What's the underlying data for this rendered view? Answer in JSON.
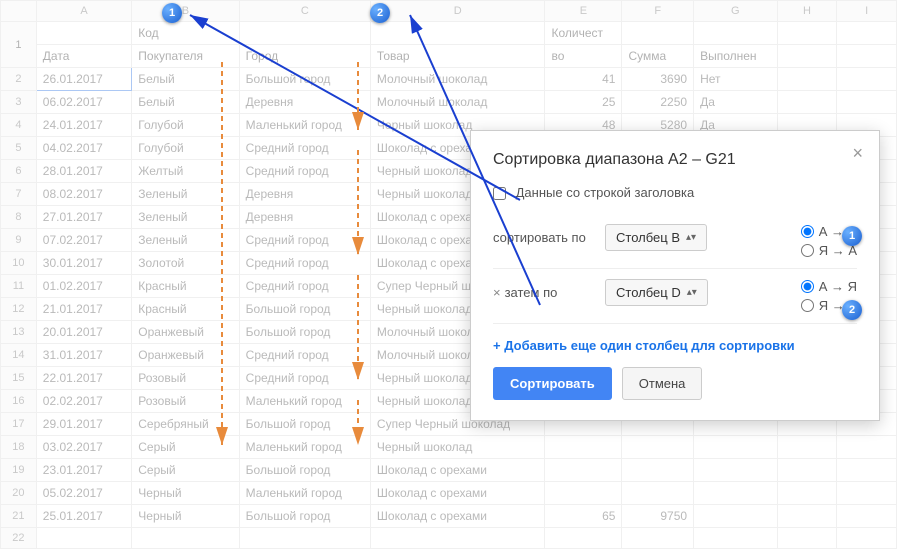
{
  "cols": [
    "A",
    "B",
    "C",
    "D",
    "E",
    "F",
    "G",
    "H",
    "I"
  ],
  "headers": {
    "r1": {
      "B": "Код",
      "E": "Количест"
    },
    "r2": {
      "A": "Дата",
      "B": "Покупателя",
      "C": "Город",
      "D": "Товар",
      "E": "во",
      "F": "Сумма",
      "G": "Выполнен"
    }
  },
  "rows": [
    {
      "n": 2,
      "A": "26.01.2017",
      "B": "Белый",
      "C": "Большой город",
      "D": "Молочный шоколад",
      "E": "41",
      "F": "3690",
      "G": "Нет"
    },
    {
      "n": 3,
      "A": "06.02.2017",
      "B": "Белый",
      "C": "Деревня",
      "D": "Молочный шоколад",
      "E": "25",
      "F": "2250",
      "G": "Да"
    },
    {
      "n": 4,
      "A": "24.01.2017",
      "B": "Голубой",
      "C": "Маленький город",
      "D": "Черный шоколад",
      "E": "48",
      "F": "5280",
      "G": "Да"
    },
    {
      "n": 5,
      "A": "04.02.2017",
      "B": "Голубой",
      "C": "Средний город",
      "D": "Шоколад с орехами",
      "E": "",
      "F": "",
      "G": ""
    },
    {
      "n": 6,
      "A": "28.01.2017",
      "B": "Желтый",
      "C": "Средний город",
      "D": "Черный шоколад",
      "E": "",
      "F": "",
      "G": ""
    },
    {
      "n": 7,
      "A": "08.02.2017",
      "B": "Зеленый",
      "C": "Деревня",
      "D": "Черный шоколад",
      "E": "",
      "F": "",
      "G": ""
    },
    {
      "n": 8,
      "A": "27.01.2017",
      "B": "Зеленый",
      "C": "Деревня",
      "D": "Шоколад с орехами",
      "E": "",
      "F": "",
      "G": ""
    },
    {
      "n": 9,
      "A": "07.02.2017",
      "B": "Зеленый",
      "C": "Средний город",
      "D": "Шоколад с орехами",
      "E": "",
      "F": "",
      "G": ""
    },
    {
      "n": 10,
      "A": "30.01.2017",
      "B": "Золотой",
      "C": "Средний город",
      "D": "Шоколад с орехами",
      "E": "",
      "F": "",
      "G": ""
    },
    {
      "n": 11,
      "A": "01.02.2017",
      "B": "Красный",
      "C": "Средний город",
      "D": "Супер Черный шоколад",
      "E": "",
      "F": "",
      "G": ""
    },
    {
      "n": 12,
      "A": "21.01.2017",
      "B": "Красный",
      "C": "Большой город",
      "D": "Черный шоколад",
      "E": "",
      "F": "",
      "G": ""
    },
    {
      "n": 13,
      "A": "20.01.2017",
      "B": "Оранжевый",
      "C": "Большой город",
      "D": "Молочный шоколад",
      "E": "",
      "F": "",
      "G": ""
    },
    {
      "n": 14,
      "A": "31.01.2017",
      "B": "Оранжевый",
      "C": "Средний город",
      "D": "Молочный шоколад",
      "E": "",
      "F": "",
      "G": ""
    },
    {
      "n": 15,
      "A": "22.01.2017",
      "B": "Розовый",
      "C": "Средний город",
      "D": "Черный шоколад",
      "E": "",
      "F": "",
      "G": ""
    },
    {
      "n": 16,
      "A": "02.02.2017",
      "B": "Розовый",
      "C": "Маленький город",
      "D": "Черный шоколад",
      "E": "",
      "F": "",
      "G": ""
    },
    {
      "n": 17,
      "A": "29.01.2017",
      "B": "Серебряный",
      "C": "Большой город",
      "D": "Супер Черный шоколад",
      "E": "",
      "F": "",
      "G": ""
    },
    {
      "n": 18,
      "A": "03.02.2017",
      "B": "Серый",
      "C": "Маленький город",
      "D": "Черный шоколад",
      "E": "",
      "F": "",
      "G": ""
    },
    {
      "n": 19,
      "A": "23.01.2017",
      "B": "Серый",
      "C": "Большой город",
      "D": "Шоколад с орехами",
      "E": "",
      "F": "",
      "G": ""
    },
    {
      "n": 20,
      "A": "05.02.2017",
      "B": "Черный",
      "C": "Маленький город",
      "D": "Шоколад с орехами",
      "E": "",
      "F": "",
      "G": ""
    },
    {
      "n": 21,
      "A": "25.01.2017",
      "B": "Черный",
      "C": "Большой город",
      "D": "Шоколад с орехами",
      "E": "65",
      "F": "9750",
      "G": ""
    }
  ],
  "dialog": {
    "title": "Сортировка диапазона A2 – G21",
    "checkbox": "Данные со строкой заголовка",
    "sort_by": "сортировать по",
    "then_by": "затем по",
    "col_b": "Столбец B",
    "col_d": "Столбец D",
    "asc": "А → Я",
    "desc": "Я → А",
    "add": "+ Добавить еще один столбец для сортировки",
    "ok": "Сортировать",
    "cancel": "Отмена"
  }
}
